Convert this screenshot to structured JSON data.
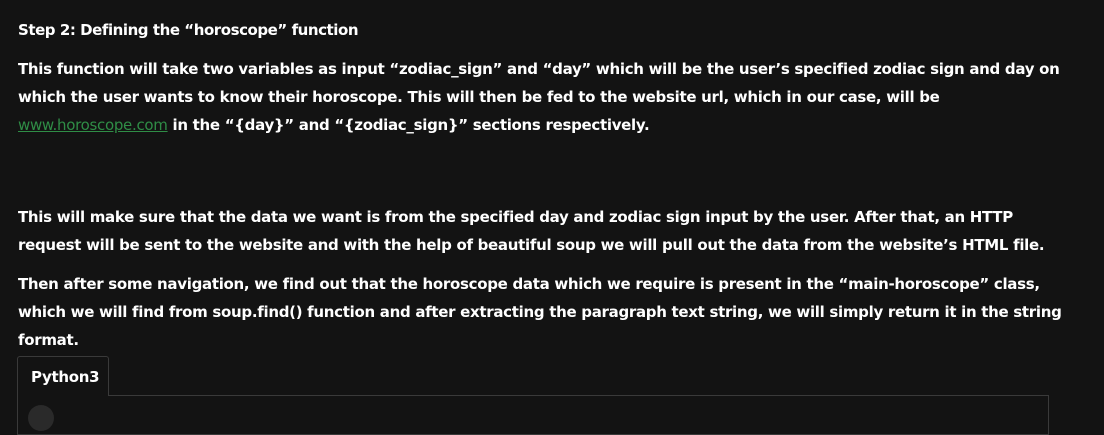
{
  "article": {
    "heading": "Step 2: Defining the “horoscope” function",
    "p1_before_link": "This function will take two variables as input “zodiac_sign” and “day” which will be the user’s specified zodiac sign and day on which the user wants to know their horoscope. This will then be fed to the website url, which in our case, will be ",
    "p1_link": "www.horoscope.com",
    "p1_after_link": " in the “{day}” and “{zodiac_sign}” sections respectively.",
    "p2": "This will make sure that the data we want is from the specified day and zodiac sign input by the user. After that, an HTTP request will be sent to the website and with the help of beautiful soup we will pull out the data from the website’s HTML file.",
    "p3": "Then after some navigation, we find out that the horoscope data which we require is present in the “main-horoscope” class, which we will find from soup.find() function and after extracting the paragraph text string, we will simply return it in the string format."
  },
  "code": {
    "tab_label": "Python3"
  },
  "colors": {
    "background": "#131313",
    "text": "#ffffff",
    "link": "#2f8d46",
    "border": "#3a3a3a"
  }
}
